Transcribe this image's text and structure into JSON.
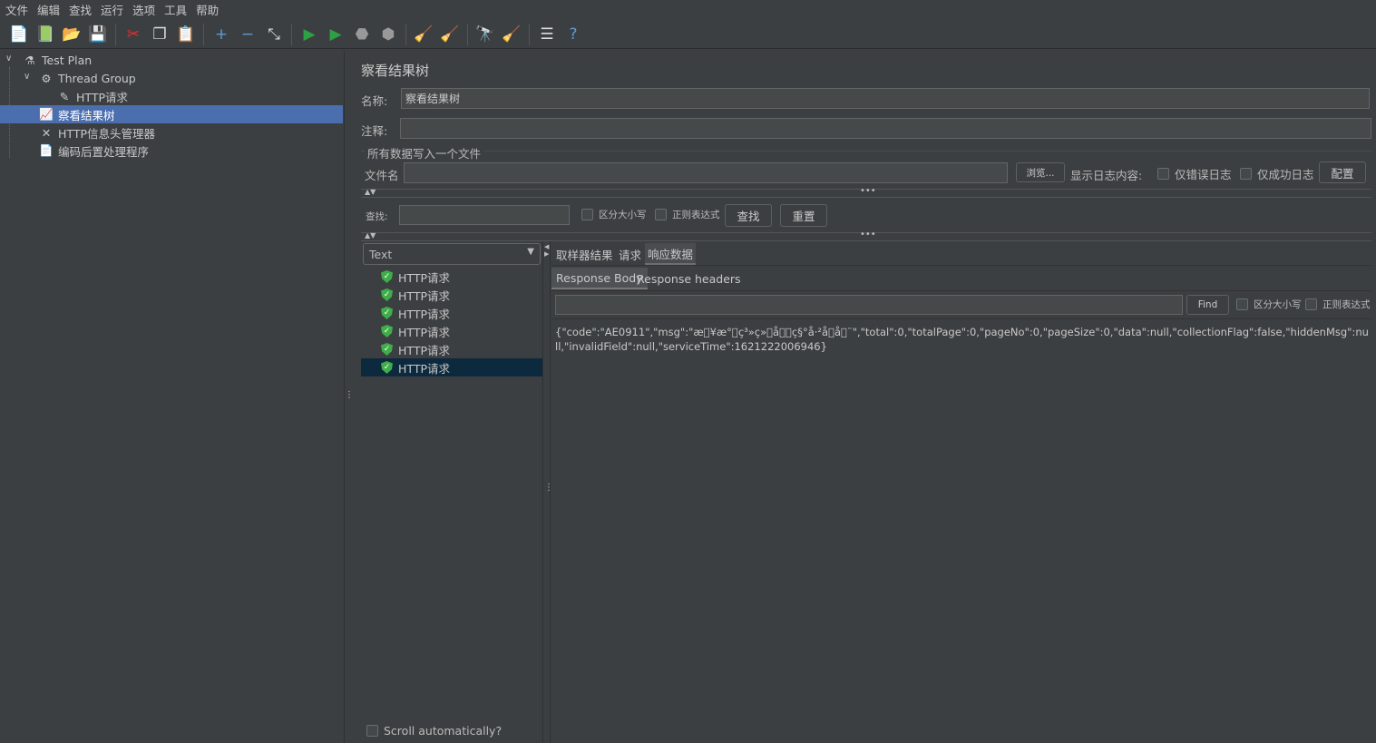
{
  "menu": [
    "文件",
    "编辑",
    "查找",
    "运行",
    "选项",
    "工具",
    "帮助"
  ],
  "toolbar": [
    {
      "icon": "new-icon",
      "g": "📄"
    },
    {
      "icon": "templates-icon",
      "g": "📗"
    },
    {
      "icon": "open-icon",
      "g": "📂"
    },
    {
      "icon": "save-icon",
      "g": "💾"
    },
    "sep",
    {
      "icon": "cut-icon",
      "g": "✂"
    },
    {
      "icon": "copy-icon",
      "g": "❐"
    },
    {
      "icon": "paste-icon",
      "g": "📋"
    },
    "sep",
    {
      "icon": "expand-icon",
      "g": "+"
    },
    {
      "icon": "collapse-icon",
      "g": "−"
    },
    {
      "icon": "toggle-icon",
      "g": "⤡"
    },
    "sep",
    {
      "icon": "start-icon",
      "g": "▶"
    },
    {
      "icon": "start-no-pauses-icon",
      "g": "▶"
    },
    {
      "icon": "stop-icon",
      "g": "⬣"
    },
    {
      "icon": "shutdown-icon",
      "g": "⬢"
    },
    "sep",
    {
      "icon": "clear-icon",
      "g": "🧹"
    },
    {
      "icon": "clear-all-icon",
      "g": "🧹"
    },
    "sep",
    {
      "icon": "search-icon",
      "g": "🔭"
    },
    {
      "icon": "reset-search-icon",
      "g": "🧹"
    },
    "sep",
    {
      "icon": "function-helper-icon",
      "g": "☰"
    },
    {
      "icon": "help-icon",
      "g": "?"
    }
  ],
  "tree": [
    {
      "label": "Test Plan",
      "icon": "flask-icon",
      "g": "⚗"
    },
    {
      "label": "Thread Group",
      "icon": "gear-icon",
      "g": "⚙"
    },
    {
      "label": "HTTP请求",
      "icon": "sampler-icon",
      "g": "✎"
    },
    {
      "label": "察看结果树",
      "icon": "listener-icon",
      "g": "📈"
    },
    {
      "label": "HTTP信息头管理器",
      "icon": "tools-icon",
      "g": "✕"
    },
    {
      "label": "编码后置处理程序",
      "icon": "document-icon",
      "g": "📄"
    }
  ],
  "panel": {
    "title": "察看结果树",
    "name_label": "名称:",
    "name_value": "察看结果树",
    "comment_label": "注释:",
    "comment_value": "",
    "file_section": "所有数据写入一个文件",
    "file_label": "文件名",
    "file_value": "",
    "browse": "浏览...",
    "log_label": "显示日志内容:",
    "errors_only": "仅错误日志",
    "success_only": "仅成功日志",
    "configure": "配置"
  },
  "search": {
    "label": "查找:",
    "value": "",
    "case": "区分大小写",
    "regex": "正则表达式",
    "find": "查找",
    "reset": "重置"
  },
  "renderer": "Text",
  "results": [
    "HTTP请求",
    "HTTP请求",
    "HTTP请求",
    "HTTP请求",
    "HTTP请求",
    "HTTP请求"
  ],
  "scroll_auto": "Scroll automatically?",
  "tabs": [
    "取样器结果",
    "请求",
    "响应数据"
  ],
  "subtabs": [
    "Response Body",
    "Response headers"
  ],
  "body_search": {
    "value": "",
    "find": "Find",
    "case": "区分大小写",
    "regex": "正则表达式"
  },
  "response_body": "{\"code\":\"AE0911\",\"msg\":\"æ\u0000¥æ°\u0000ç³»ç»\u0000å\u0000\u0000ç§°å·²å­\u0000å\u0000¨\",\"total\":0,\"totalPage\":0,\"pageNo\":0,\"pageSize\":0,\"data\":null,\"collectionFlag\":false,\"hiddenMsg\":null,\"invalidField\":null,\"serviceTime\":1621222006946}"
}
